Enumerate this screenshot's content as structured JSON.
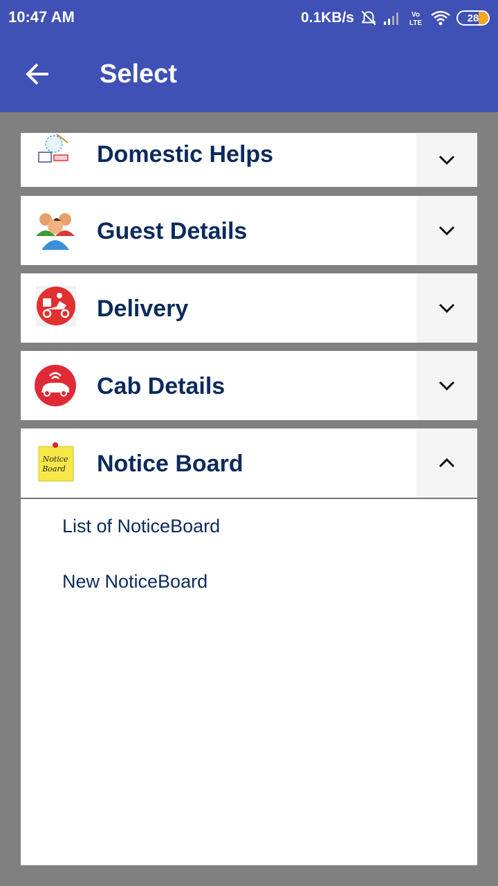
{
  "status_bar": {
    "time": "10:47 AM",
    "net_speed": "0.1KB/s",
    "battery": "28",
    "icons": [
      "alarm-off-icon",
      "signal-icon",
      "volte-icon",
      "wifi-icon",
      "battery-icon"
    ]
  },
  "appbar": {
    "title": "Select",
    "back_icon": "arrow-left-icon"
  },
  "menu": {
    "items": [
      {
        "label": "Domestic Helps",
        "icon": "domestic-help-icon",
        "expanded": false
      },
      {
        "label": "Guest Details",
        "icon": "guests-icon",
        "expanded": false
      },
      {
        "label": "Delivery",
        "icon": "delivery-scooter-icon",
        "expanded": false
      },
      {
        "label": "Cab Details",
        "icon": "cab-icon",
        "expanded": false
      },
      {
        "label": "Notice Board",
        "icon": "notice-board-icon",
        "expanded": true
      }
    ],
    "notice_board_children": [
      "List of NoticeBoard",
      "New NoticeBoard"
    ],
    "notice_icon_text": "Notice Board"
  },
  "colors": {
    "primary": "#3f51b5",
    "label_text": "#0b2a5c",
    "background": "#808080"
  }
}
